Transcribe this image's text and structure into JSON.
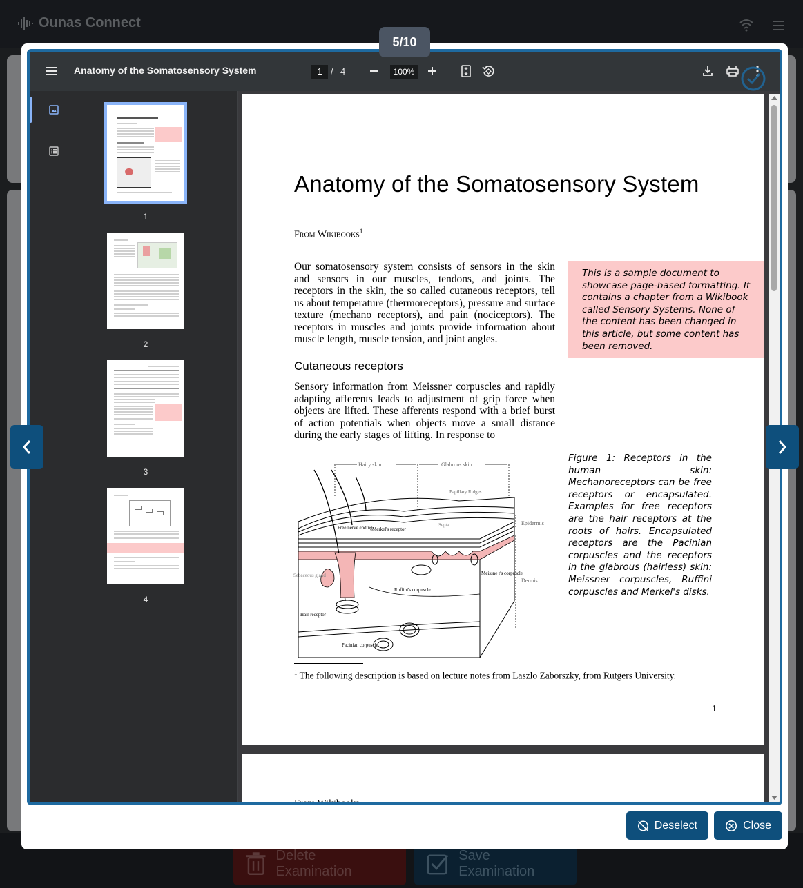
{
  "app": {
    "name": "Ounas Connect"
  },
  "background": {
    "delete_label": "Delete Examination",
    "save_label": "Save Examination"
  },
  "counter": "5/10",
  "viewer": {
    "doc_title": "Anatomy of the Somatosensory System",
    "current_page": "1",
    "page_separator": "/",
    "total_pages": "4",
    "zoom": "100%",
    "thumbnails": [
      {
        "label": "1"
      },
      {
        "label": "2"
      },
      {
        "label": "3"
      },
      {
        "label": "4"
      }
    ]
  },
  "document": {
    "title": "Anatomy of the Somatosensory System",
    "from": "From Wikibooks",
    "from_sup": "1",
    "intro": "Our somatosensory system consists of sensors in the skin and sensors in our muscles, tendons, and joints. The receptors in the skin, the so called cutaneous receptors, tell us about temperature (thermoreceptors), pressure and surface texture (mechano receptors), and pain (nociceptors). The receptors in muscles and joints provide information about muscle length, muscle tension, and joint angles.",
    "note": "This is a sample document to showcase page-based formatting. It contains a chapter from a Wikibook called Sensory Systems. None of the content has been changed in this article, but some content has been removed.",
    "section_heading": "Cutaneous receptors",
    "section_para": "Sensory information from Meissner corpuscles and rapidly adapting afferents leads to adjustment of grip force when objects are lifted. These afferents respond with a brief burst of action potentials when objects move a small distance during the early stages of lifting. In response to",
    "figure_caption": "Figure 1: Receptors in the human skin: Mechanoreceptors can be free receptors or encapsulated. Examples for free receptors are the hair receptors at the roots of hairs. Encapsulated receptors are the Pacinian corpuscles and the receptors in the glabrous (hairless) skin: Meissner corpuscles, Ruffini corpuscles and Merkel's disks.",
    "figure_labels": {
      "hairy_skin": "Hairy skin",
      "glabrous_skin": "Glabrous skin",
      "papillary_ridges": "Papillary Ridges",
      "septa": "Septa",
      "epidermis": "Epidermis",
      "dermis": "Dermis",
      "free_nerve_ending": "Free nerve ending",
      "merkels_receptor": "Merkel's receptor",
      "sebaceous_gland": "Sebaceous gland",
      "ruffinis_corpuscle": "Ruffini's corpuscle",
      "meissners_corpuscle": "Meissne r's corpuscle",
      "hair_receptor": "Hair receptor",
      "pacinian_corpuscle": "Pacinian corpuscle"
    },
    "footnote_num": "1",
    "footnote": "The following description is based on lecture notes from Laszlo Zaborszky, from Rutgers University.",
    "page_number": "1",
    "page2_fragment": "From Wikibooks"
  },
  "modal": {
    "deselect_label": "Deselect",
    "close_label": "Close"
  },
  "colors": {
    "accent": "#0e4f7c",
    "frame": "#1e6aa0",
    "note_bg": "#fccaca",
    "toolbar": "#323639"
  },
  "icons": [
    "waveform-icon",
    "wifi-icon",
    "menu-icon",
    "trash-icon",
    "checkbox-icon",
    "download-icon",
    "print-icon",
    "more-vert-icon",
    "fit-page-icon",
    "rotate-icon",
    "thumbnail-icon",
    "outline-icon",
    "check-circle-icon",
    "chevron-left-icon",
    "chevron-right-icon",
    "deselect-icon",
    "close-circle-icon"
  ]
}
